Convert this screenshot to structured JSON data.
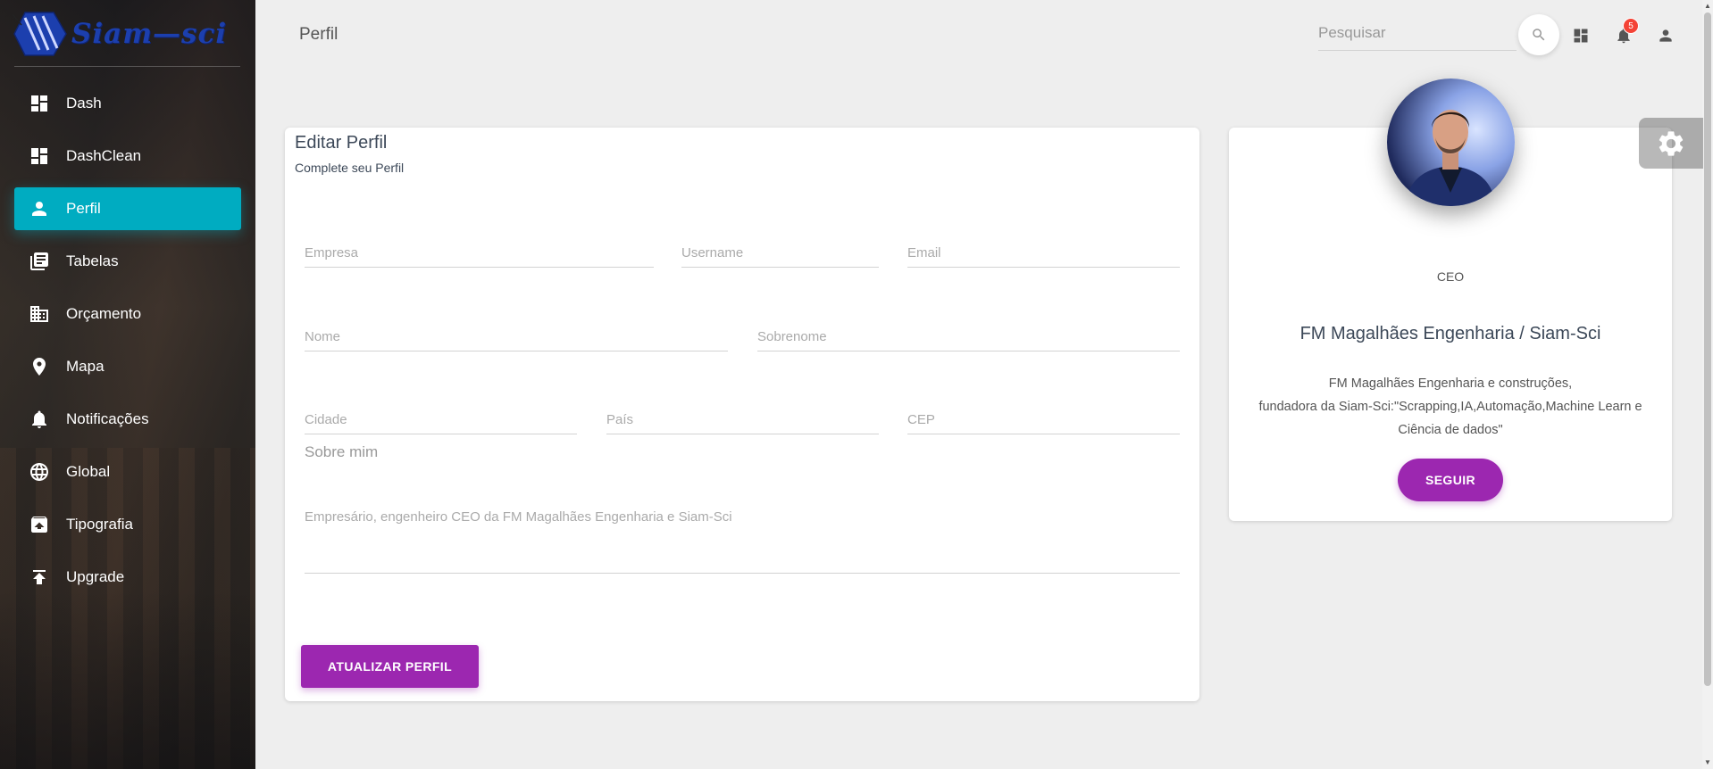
{
  "brand": {
    "name": "Siam—sci",
    "color": "#1c3fae"
  },
  "sidebar": {
    "items": [
      {
        "label": "Dash",
        "icon": "dashboard-icon"
      },
      {
        "label": "DashClean",
        "icon": "dashboard-icon"
      },
      {
        "label": "Perfil",
        "icon": "person-icon",
        "active": true
      },
      {
        "label": "Tabelas",
        "icon": "library-books-icon"
      },
      {
        "label": "Orçamento",
        "icon": "business-icon"
      },
      {
        "label": "Mapa",
        "icon": "location-icon"
      },
      {
        "label": "Notificações",
        "icon": "bell-icon"
      },
      {
        "label": "Global",
        "icon": "globe-icon"
      },
      {
        "label": "Tipografia",
        "icon": "unarchive-icon"
      },
      {
        "label": "Upgrade",
        "icon": "upload-icon"
      }
    ],
    "active_color": "#00acc1"
  },
  "header": {
    "title": "Perfil",
    "search_placeholder": "Pesquisar",
    "notification_count": "5"
  },
  "edit_profile": {
    "title": "Editar Perfil",
    "subtitle": "Complete seu Perfil",
    "fields": {
      "empresa": "Empresa",
      "username": "Username",
      "email": "Email",
      "nome": "Nome",
      "sobrenome": "Sobrenome",
      "cidade": "Cidade",
      "pais": "País",
      "cep": "CEP"
    },
    "about_label": "Sobre mim",
    "about_placeholder": "Empresário, engenheiro CEO da FM Magalhães Engenharia e Siam-Sci",
    "submit_label": "ATUALIZAR PERFIL",
    "accent": "#9c27b0"
  },
  "profile_card": {
    "role": "CEO",
    "company": "FM Magalhães Engenharia / Siam-Sci",
    "description_lines": [
      "FM Magalhães Engenharia e construções,",
      "fundadora da Siam-Sci:\"Scrapping,IA,Automação,Machine Learn e",
      "Ciência de dados\""
    ],
    "follow_label": "SEGUIR"
  }
}
